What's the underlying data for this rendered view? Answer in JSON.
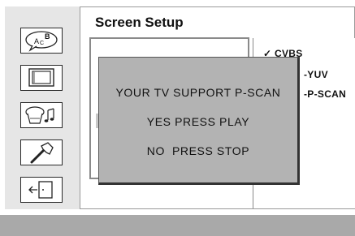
{
  "screen": {
    "title": "Screen Setup"
  },
  "sidebar": {
    "icons": [
      "language-bubble-icon",
      "tv-screen-icon",
      "audio-speaker-icon",
      "tools-icon",
      "exit-door-icon"
    ]
  },
  "options": {
    "item1": "✓ CVBS",
    "item2": "YUV",
    "item3": "P-SCAN"
  },
  "dialog": {
    "line1": "YOUR TV SUPPORT P-SCAN",
    "line2": "YES PRESS PLAY",
    "line3": "NO  PRESS STOP"
  },
  "colors": {
    "dialog_bg": "#b3b3b3",
    "sidebar_bg": "#e6e6e6",
    "bottom_bar": "#a9a9a9"
  }
}
